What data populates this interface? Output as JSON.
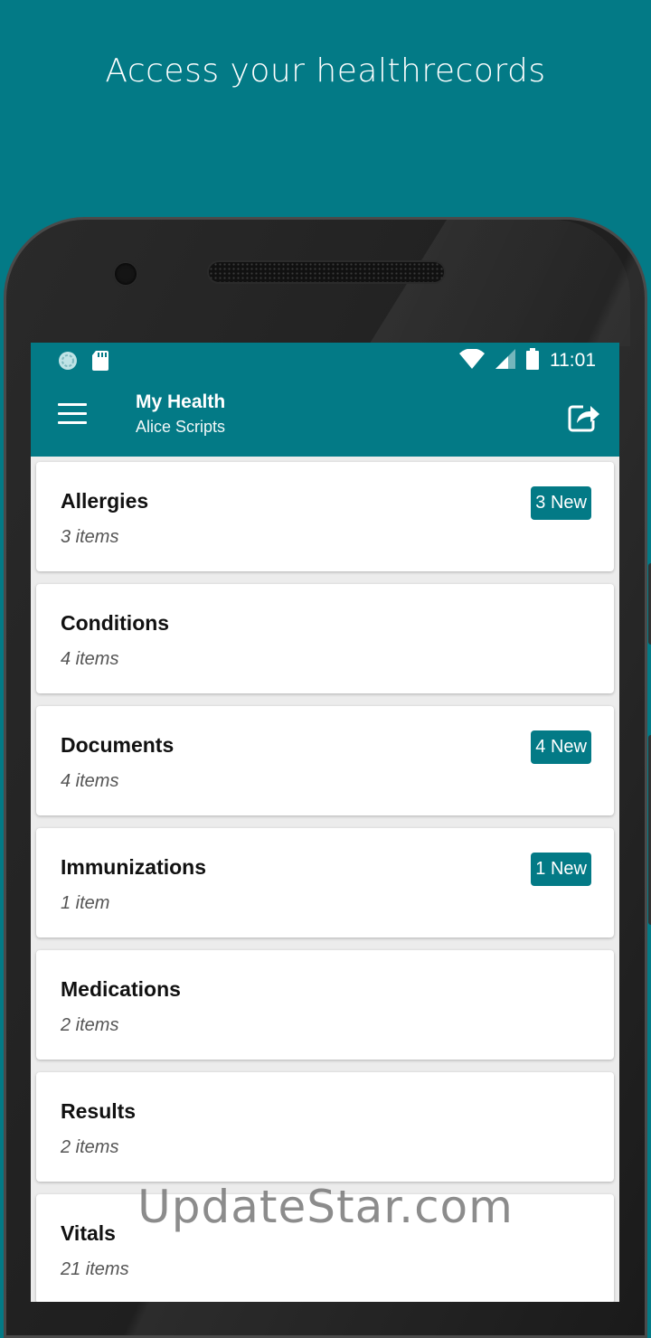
{
  "tagline": "Access your healthrecords",
  "status_bar": {
    "time": "11:01",
    "icons": [
      "sync-icon",
      "sd-card-icon",
      "wifi-icon",
      "signal-icon",
      "battery-icon"
    ]
  },
  "app_bar": {
    "title": "My Health",
    "subtitle": "Alice Scripts",
    "menu_icon": "hamburger-menu-icon",
    "share_icon": "share-icon"
  },
  "categories": [
    {
      "name": "Allergies",
      "count": "3 items",
      "badge": "3 New"
    },
    {
      "name": "Conditions",
      "count": "4 items",
      "badge": ""
    },
    {
      "name": "Documents",
      "count": "4 items",
      "badge": "4 New"
    },
    {
      "name": "Immunizations",
      "count": "1 item",
      "badge": "1 New"
    },
    {
      "name": "Medications",
      "count": "2 items",
      "badge": ""
    },
    {
      "name": "Results",
      "count": "2 items",
      "badge": ""
    },
    {
      "name": "Vitals",
      "count": "21 items",
      "badge": ""
    }
  ],
  "watermark": "UpdateStar.com",
  "colors": {
    "accent": "#037a86",
    "background": "#037a86",
    "card": "#ffffff",
    "list_background": "#ececec"
  }
}
